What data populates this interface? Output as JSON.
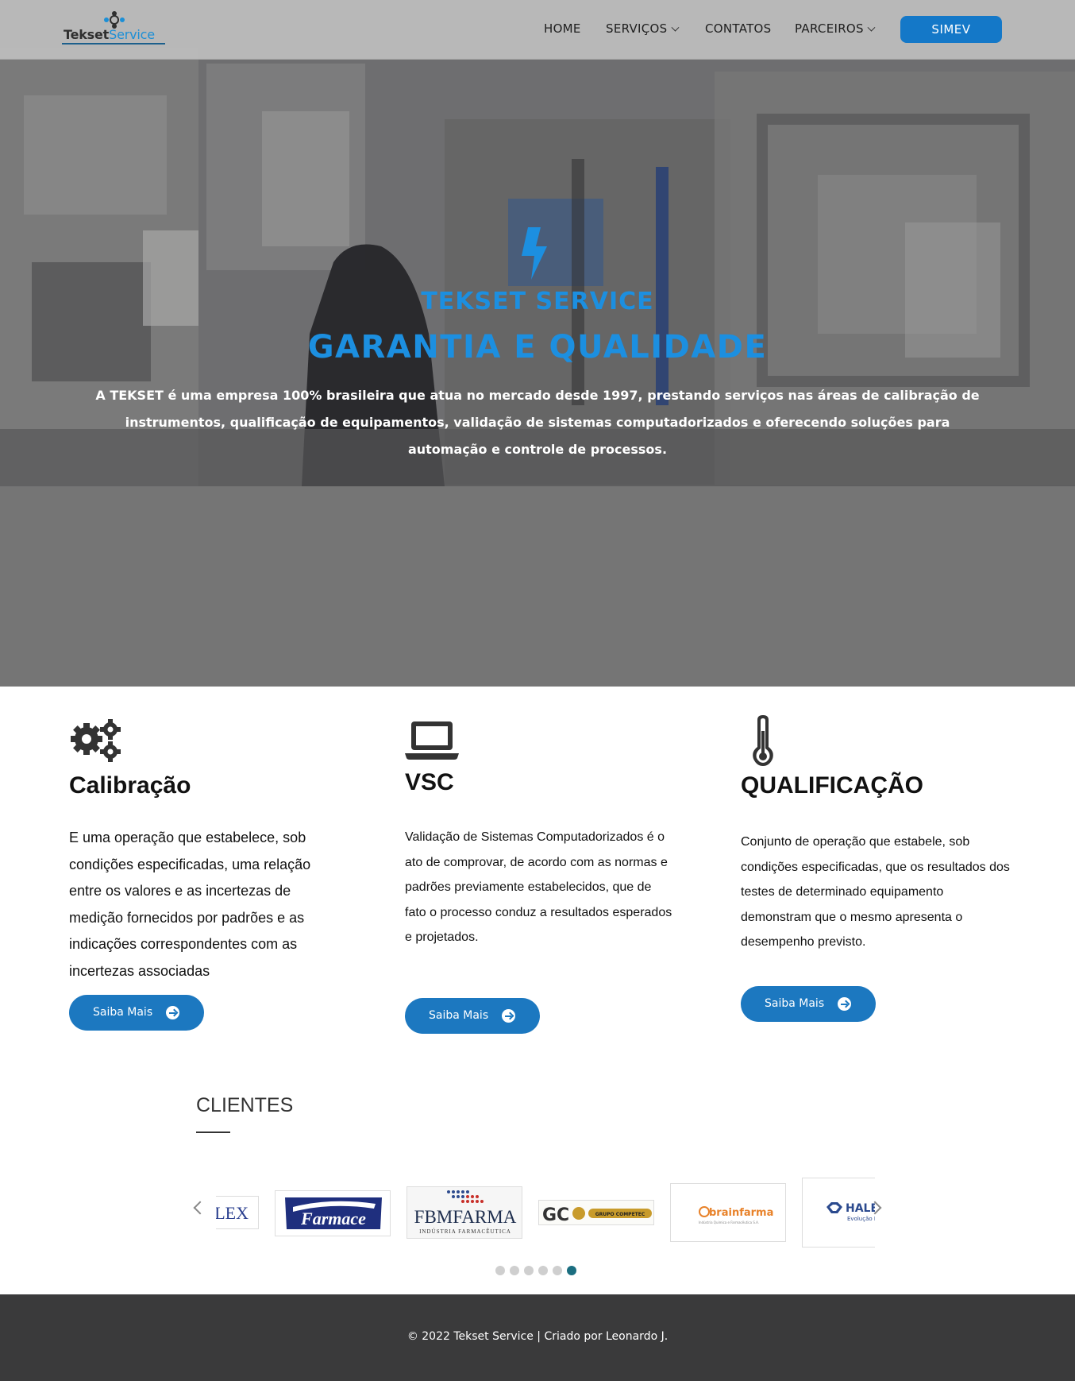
{
  "header": {
    "logo_text_1": "Tekset",
    "logo_text_2": "Service",
    "nav": [
      {
        "label": "HOME"
      },
      {
        "label": "SERVIÇOS"
      },
      {
        "label": "CONTATOS"
      },
      {
        "label": "PARCEIROS"
      }
    ],
    "cta_label": "SIMEV"
  },
  "hero": {
    "icon": "lightning-bolt-icon",
    "subtitle": "TEKSET SERVICE",
    "title": "GARANTIA E QUALIDADE",
    "text": "A TEKSET é uma empresa 100% brasileira que atua no mercado desde 1997, prestando serviços nas áreas de calibração de instrumentos, qualificação de equipamentos, validação de sistemas computadorizados e oferecendo soluções para automação e controle de processos."
  },
  "services": [
    {
      "icon": "gears-icon",
      "title": "Calibração",
      "text": "E uma operação que estabelece, sob condições especificadas, uma relação entre os valores e as incertezas de medição fornecidos por padrões e as indicações correspondentes com as incertezas associadas",
      "button": "Saiba Mais"
    },
    {
      "icon": "laptop-icon",
      "title": "VSC",
      "text": "Validação de Sistemas Computadorizados é o ato de comprovar, de acordo com as normas e padrões previamente estabelecidos, que de fato o processo conduz a resultados esperados e projetados.",
      "button": "Saiba Mais"
    },
    {
      "icon": "thermometer-icon",
      "title": "QUALIFICAÇÃO",
      "text": "Conjunto de operação que estabele, sob condições especificadas, que os resultados dos testes de determinado equipamento demonstram que o mesmo apresenta o desempenho previsto.",
      "button": "Saiba Mais"
    }
  ],
  "clients": {
    "title": "CLIENTES",
    "logos": [
      {
        "name": "PLEX"
      },
      {
        "name": "Farmace"
      },
      {
        "name": "FBMFARMA",
        "tagline": "INDÚSTRIA FARMACÊUTICA"
      },
      {
        "name": "GC",
        "tagline": "GRUPO COMPETEC"
      },
      {
        "name": "brainfarma",
        "tagline": "Indústria Química e Farmacêutica S.A."
      },
      {
        "name": "HALEX",
        "tagline": "Evolução Pe"
      }
    ],
    "dots_total": 6,
    "active_dot": 6
  },
  "footer": {
    "text": "© 2022 Tekset Service | Criado por Leonardo J."
  },
  "colors": {
    "brand_blue": "#1c8fe0",
    "button_blue": "#1c78c0",
    "footer_bg": "#3a3a3b",
    "active_dot": "#1b6e80"
  }
}
